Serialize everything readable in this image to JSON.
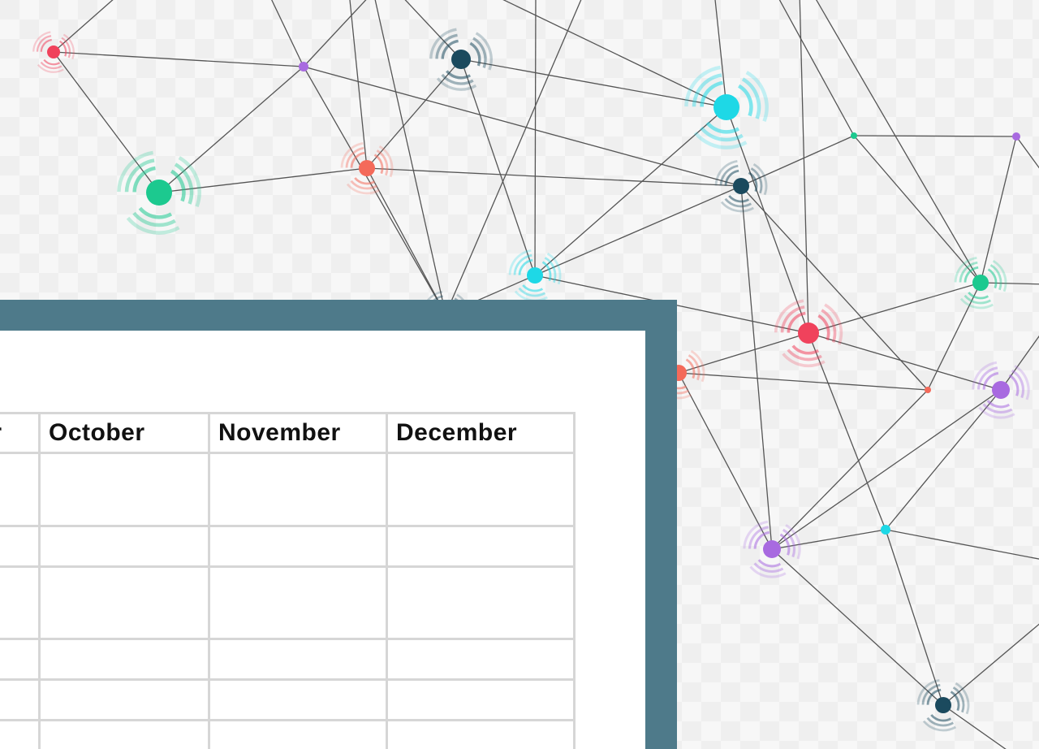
{
  "background": {
    "colors": {
      "pink": "#f0425c",
      "coral": "#f46a5a",
      "purple": "#a86ae0",
      "navy": "#1b4a5e",
      "cyan": "#1ed8e6",
      "teal": "#1cc98f",
      "line": "#555555"
    }
  },
  "frame": {
    "color": "#4e7a8a"
  },
  "table": {
    "headers": [
      "September",
      "October",
      "November",
      "December"
    ],
    "rows": [
      [
        "",
        "",
        "",
        ""
      ],
      [
        "",
        "",
        "",
        ""
      ],
      [
        "",
        "",
        "",
        ""
      ],
      [
        "",
        "",
        "",
        ""
      ],
      [
        "",
        "",
        "",
        ""
      ],
      [
        "",
        "",
        "",
        ""
      ]
    ]
  }
}
